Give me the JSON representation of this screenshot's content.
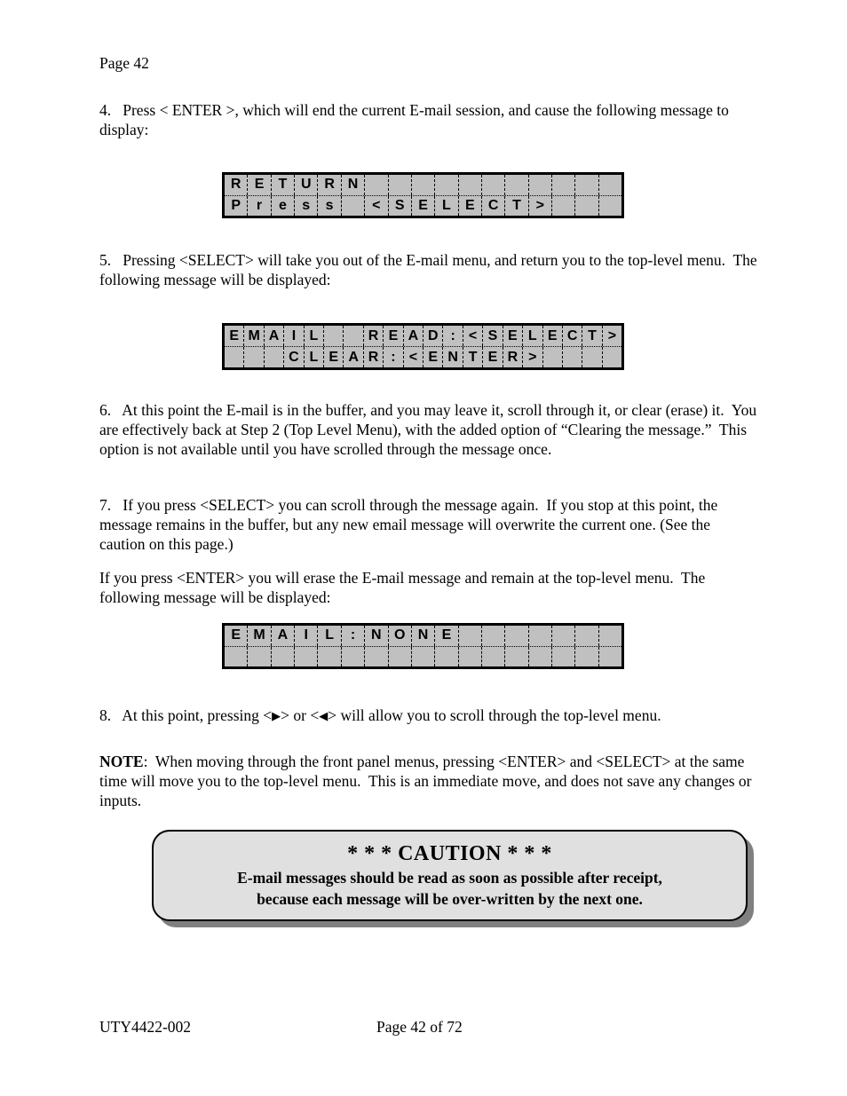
{
  "document": {
    "page_label": "Page 42",
    "footer_left": "UTY4422-002",
    "footer_center": "Page 42 of 72"
  },
  "paragraphs": {
    "step4": "4.   Press < ENTER >, which will end the current E-mail session, and cause the following message to display:",
    "step5": "5.   Pressing <SELECT> will take you out of the E-mail menu, and return you to the top-level menu.  The following message will be displayed:",
    "step6": "6.   At this point the E-mail is in the buffer, and you may leave it, scroll through it, or clear (erase) it.  You are effectively back at Step 2 (Top Level Menu), with the added option of “Clearing the message.”  This option is not available until you have scrolled through the message once.",
    "step7": "7.   If you press <SELECT> you can scroll through the message again.  If you stop at this point, the message remains in the buffer, but any new email message will overwrite the current one. (See the caution on this page.)",
    "step7b": "If you press <ENTER> you will erase the E-mail message and remain at the top-level menu.  The following message will be displayed:",
    "step8_prefix": "8.   At this point, pressing <",
    "step8_right_arrow": "▶",
    "step8_middle": "> or <",
    "step8_left_arrow": "◀",
    "step8_suffix": "> will allow you to scroll through the top-level menu.",
    "note_label": "NOTE",
    "note_body": ":  When moving through the front panel menus, pressing <ENTER> and <SELECT> at the same time will move you to the top-level menu.  This is an immediate move, and does not save any changes or inputs."
  },
  "lcd_displays": [
    {
      "name": "return-press-select",
      "columns": 17,
      "line1": "RETURN           ",
      "line2": "Press <SELECT>   "
    },
    {
      "name": "email-read-clear",
      "columns": 20,
      "line1": "EMAIL  READ:<SELECT>",
      "line2": "   CLEAR:<ENTER>    "
    },
    {
      "name": "email-none",
      "columns": 17,
      "line1": "EMAIL:NONE       ",
      "line2": "                 "
    }
  ],
  "caution": {
    "title": "* * * CAUTION * * *",
    "line1": "E-mail messages should be read as soon as possible after receipt,",
    "line2": "because each message will be over-written by the next one."
  },
  "colors": {
    "lcd_background": "#c0c0c0",
    "lcd_border": "#000000",
    "caution_background": "#e0e0e0",
    "caution_shadow": "#808080",
    "text": "#000000",
    "page_background": "#ffffff"
  }
}
